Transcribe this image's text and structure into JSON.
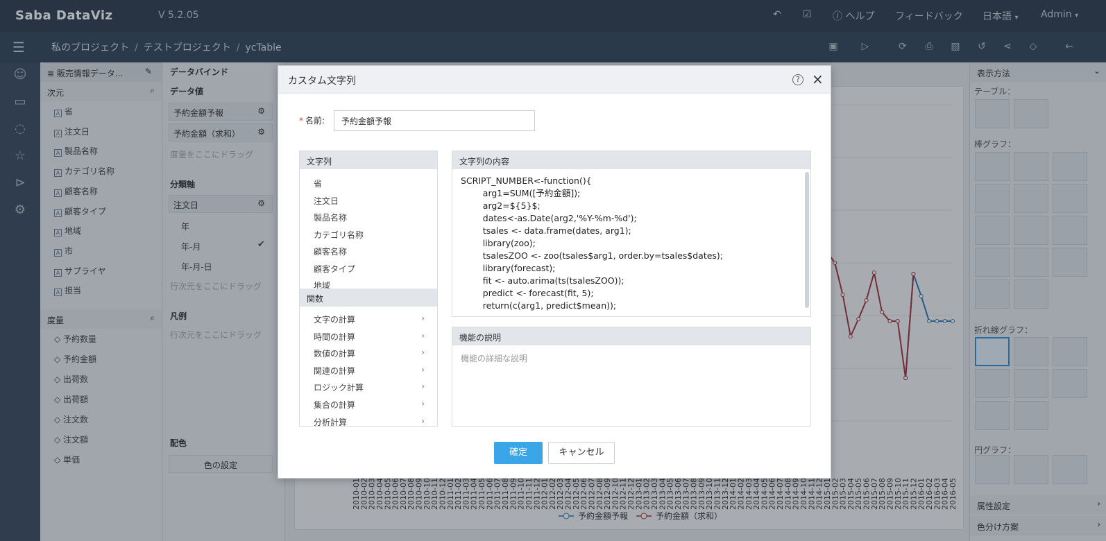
{
  "app": {
    "logo": "Saba DataViz",
    "version": "V 5.2.05"
  },
  "topbar": {
    "help": "ヘルプ",
    "feedback": "フィードバック",
    "language": "日本語",
    "user": "Admin"
  },
  "breadcrumb": [
    "私のプロジェクト",
    "テストプロジェクト",
    "ycTable"
  ],
  "dataset": {
    "title": "販売情報データ...",
    "dimension_header": "次元",
    "dimensions": [
      "省",
      "注文日",
      "製品名称",
      "カテゴリ名称",
      "顧客名称",
      "顧客タイプ",
      "地域",
      "市",
      "サプライヤ",
      "担当"
    ],
    "measure_header": "度量",
    "measures": [
      "予約数量",
      "予約金額",
      "出荷数",
      "出荷額",
      "注文数",
      "注文額",
      "単価"
    ]
  },
  "bind": {
    "title": "データバインド",
    "values_header": "データ値",
    "values": [
      "予約金額予報",
      "予約金額（求和）"
    ],
    "values_hint": "度量をここにドラッグ",
    "axis_header": "分類軸",
    "axis_field": "注文日",
    "axis_options": [
      "年",
      "年-月",
      "年-月-日"
    ],
    "axis_hint": "行次元をここにドラッグ",
    "legend_header": "凡例",
    "legend_hint": "行次元をここにドラッグ",
    "color_header": "配色",
    "color_button": "色の設定"
  },
  "chart": {
    "legend": [
      "予約金額予報",
      "予約金額（求和）"
    ],
    "x_ticks": [
      "2010-01",
      "2010-02",
      "2010-03",
      "2010-04",
      "2010-05",
      "2010-06",
      "2010-07",
      "2010-08",
      "2010-09",
      "2010-10",
      "2010-11",
      "2010-12",
      "2011-01",
      "2011-02",
      "2011-03",
      "2011-04",
      "2011-05",
      "2011-06",
      "2011-07",
      "2011-08",
      "2011-09",
      "2011-10",
      "2011-11",
      "2011-12",
      "2012-01",
      "2012-02",
      "2012-03",
      "2012-04",
      "2012-05",
      "2012-06",
      "2012-07",
      "2012-08",
      "2012-09",
      "2012-10",
      "2012-11",
      "2012-12",
      "2013-01",
      "2013-02",
      "2013-03",
      "2013-04",
      "2013-05",
      "2013-06",
      "2013-07",
      "2013-08",
      "2013-09",
      "2013-10",
      "2013-11",
      "2013-12",
      "2014-01",
      "2014-02",
      "2014-03",
      "2014-04",
      "2014-05",
      "2014-06",
      "2014-07",
      "2014-08",
      "2014-09",
      "2014-10",
      "2014-11",
      "2014-12",
      "2015-01",
      "2015-02",
      "2015-03",
      "2015-04",
      "2015-05",
      "2015-06",
      "2015-07",
      "2015-08",
      "2015-09",
      "2015-10",
      "2015-11",
      "2015-12",
      "2016-01",
      "2016-02",
      "2016-03",
      "2016-04",
      "2016-05"
    ],
    "colors": {
      "forecast": "#2a78b8",
      "sum": "#a3323c"
    }
  },
  "right": {
    "header": "表示方法",
    "table_label": "テーブル：",
    "bar_label": "棒グラフ：",
    "line_label": "折れ線グラフ：",
    "pie_label": "円グラフ：",
    "attr_label": "属性設定",
    "color_label": "色分け方案"
  },
  "modal": {
    "title": "カスタム文字列",
    "name_label": "名前:",
    "name_value": "予約金額予報",
    "strings_header": "文字列",
    "strings": [
      "省",
      "注文日",
      "製品名称",
      "カテゴリ名称",
      "顧客名称",
      "顧客タイプ",
      "地域"
    ],
    "functions_header": "関数",
    "functions": [
      "文字の計算",
      "時間の計算",
      "数値の計算",
      "関連の計算",
      "ロジック計算",
      "集合の計算",
      "分析計算"
    ],
    "content_header": "文字列の内容",
    "code": "SCRIPT_NUMBER<-function(){\n        arg1=SUM([予約金額]);\n        arg2=${5}$;\n        dates<-as.Date(arg2,'%Y-%m-%d');\n        tsales <- data.frame(dates, arg1);\n        library(zoo);\n        tsalesZOO <- zoo(tsales$arg1, order.by=tsales$dates);\n        library(forecast);\n        fit <- auto.arima(ts(tsalesZOO));\n        predict <- forecast(fit, 5);\n        return(c(arg1, predict$mean));\n}",
    "desc_header": "機能の説明",
    "desc_placeholder": "機能の詳細な説明",
    "ok": "確定",
    "cancel": "キャンセル"
  }
}
